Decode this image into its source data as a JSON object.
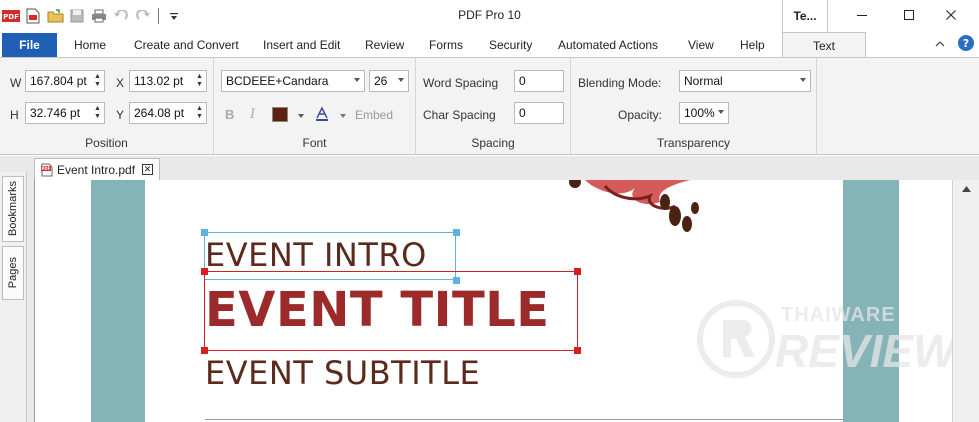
{
  "app": {
    "title": "PDF Pro 10",
    "context_tab_title": "Te..."
  },
  "tabs": [
    {
      "label": "Home"
    },
    {
      "label": "Create and Convert"
    },
    {
      "label": "Insert and Edit"
    },
    {
      "label": "Review"
    },
    {
      "label": "Forms"
    },
    {
      "label": "Security"
    },
    {
      "label": "Automated Actions"
    },
    {
      "label": "View"
    },
    {
      "label": "Help"
    },
    {
      "label": "Text"
    }
  ],
  "file_tab": "File",
  "position": {
    "w_label": "W",
    "w_value": "167.804 pt",
    "h_label": "H",
    "h_value": "32.746 pt",
    "x_label": "X",
    "x_value": "113.02 pt",
    "y_label": "Y",
    "y_value": "264.08 pt",
    "group_label": "Position"
  },
  "font": {
    "family": "BCDEEE+Candara",
    "size": "26",
    "bold_label": "B",
    "italic_label": "I",
    "color": "#5c1f10",
    "embed_label": "Embed",
    "group_label": "Font"
  },
  "spacing": {
    "word_label": "Word Spacing",
    "word_value": "0",
    "char_label": "Char Spacing",
    "char_value": "0",
    "group_label": "Spacing"
  },
  "transparency": {
    "blend_label": "Blending Mode:",
    "blend_value": "Normal",
    "opacity_label": "Opacity:",
    "opacity_value": "100%",
    "group_label": "Transparency"
  },
  "sidebar": {
    "bookmarks": "Bookmarks",
    "pages": "Pages"
  },
  "document": {
    "tab_label": "Event Intro.pdf",
    "intro_text": "EVENT INTRO",
    "title_text": "EVENT TITLE",
    "subtitle_text": "EVENT SUBTITLE",
    "watermark_top": "THAIWARE",
    "watermark_bottom": "REVIEW"
  },
  "colors": {
    "accent": "#1f5fb5",
    "band": "#84b4b8",
    "intro_text": "#5c2a1c",
    "title_text": "#9c2a2a",
    "selection_blue": "#5cb4e0",
    "selection_red": "#d61f1f"
  }
}
